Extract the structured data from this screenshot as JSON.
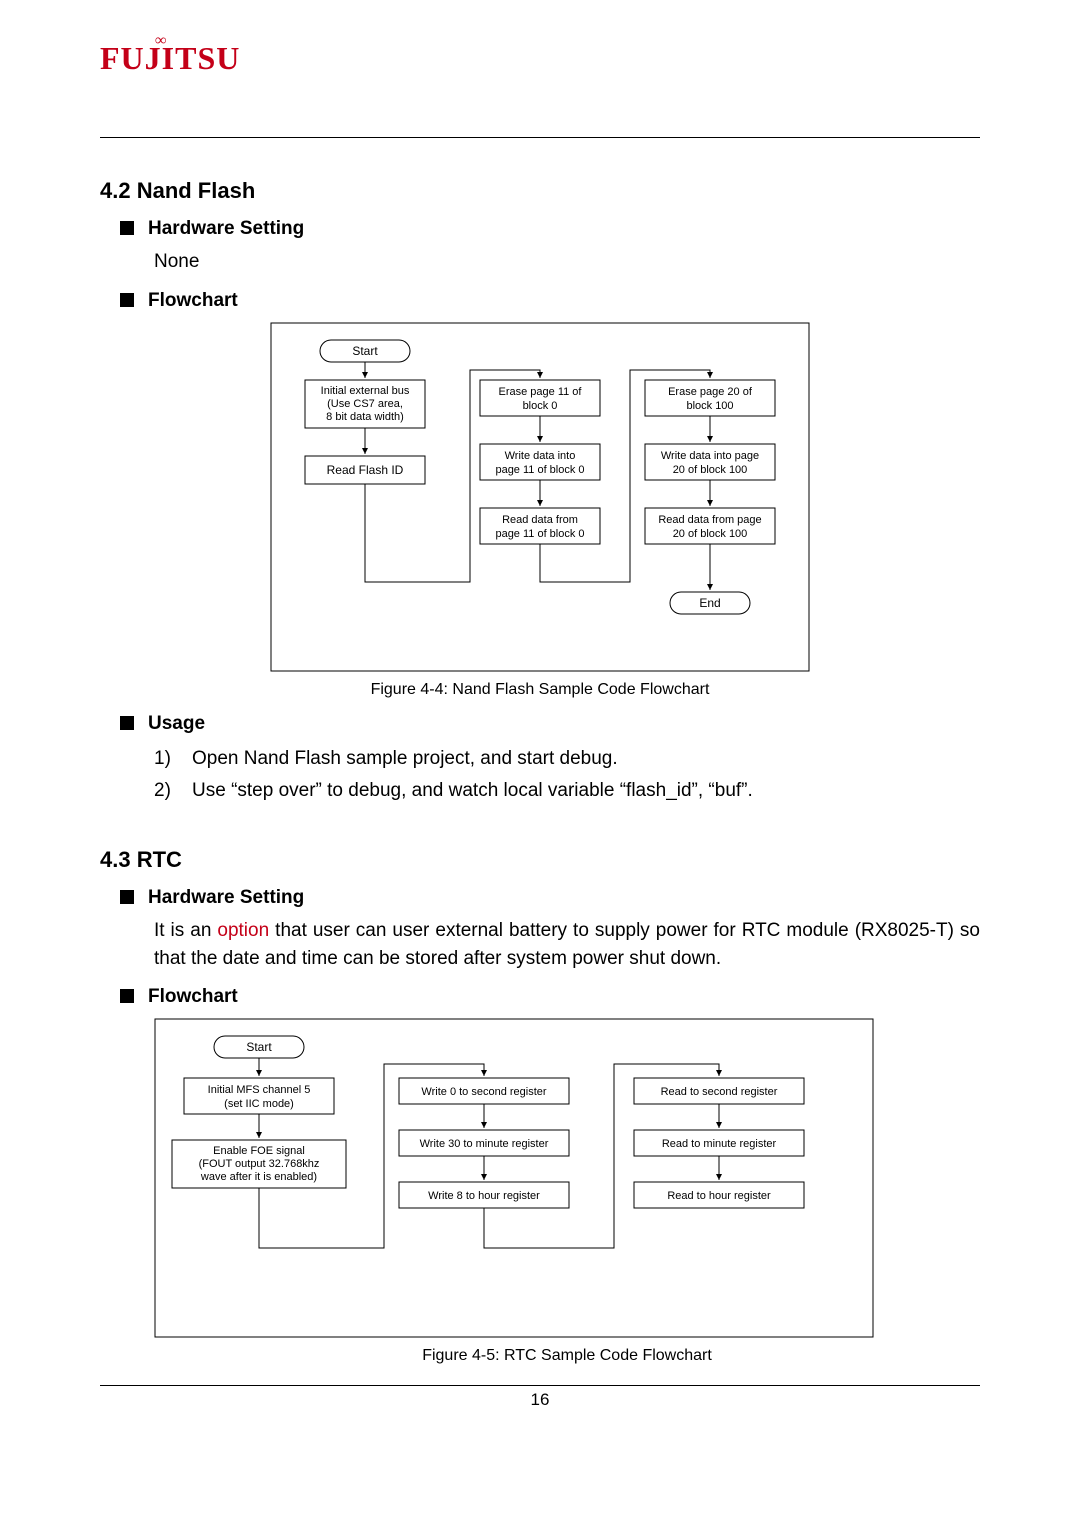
{
  "logo": "FUJITSU",
  "section_42": {
    "heading": "4.2 Nand Flash",
    "hw_label": "Hardware Setting",
    "hw_value": "None",
    "flow_label": "Flowchart",
    "usage_label": "Usage",
    "usage_items": [
      "Open Nand Flash sample project, and start debug.",
      "Use “step over” to debug, and watch local variable “flash_id”, “buf”."
    ],
    "fig_caption": "Figure 4-4:  Nand Flash Sample Code Flowchart"
  },
  "section_43": {
    "heading": "4.3 RTC",
    "hw_label": "Hardware Setting",
    "hw_text_pre": "It is an ",
    "hw_text_option": "option",
    "hw_text_post": " that user can user external battery to supply power for RTC module (RX8025-T) so that the date and time can be stored after system power shut down.",
    "flow_label": "Flowchart",
    "fig_caption": "Figure 4-5:  RTC Sample Code Flowchart"
  },
  "page_number": "16",
  "chart_data": [
    {
      "type": "flowchart",
      "title": "Nand Flash Sample Code Flowchart",
      "columns": [
        {
          "nodes": [
            {
              "shape": "terminator",
              "label": "Start"
            },
            {
              "shape": "process",
              "label": "Initial external bus (Use CS7 area, 8 bit data width)"
            },
            {
              "shape": "process",
              "label": "Read Flash ID"
            }
          ]
        },
        {
          "nodes": [
            {
              "shape": "process",
              "label": "Erase page 11 of block 0"
            },
            {
              "shape": "process",
              "label": "Write data into page 11 of block 0"
            },
            {
              "shape": "process",
              "label": "Read data from page 11 of block 0"
            }
          ]
        },
        {
          "nodes": [
            {
              "shape": "process",
              "label": "Erase page 20 of block 100"
            },
            {
              "shape": "process",
              "label": "Write data into page 20 of block 100"
            },
            {
              "shape": "process",
              "label": "Read data from page 20 of block 100"
            },
            {
              "shape": "terminator",
              "label": "End"
            }
          ]
        }
      ],
      "cross_links": [
        {
          "from": "col0.bottom",
          "to": "col1.top"
        },
        {
          "from": "col1.bottom",
          "to": "col2.top"
        }
      ]
    },
    {
      "type": "flowchart",
      "title": "RTC Sample Code Flowchart",
      "columns": [
        {
          "nodes": [
            {
              "shape": "terminator",
              "label": "Start"
            },
            {
              "shape": "process",
              "label": "Initial MFS channel 5 (set IIC mode)"
            },
            {
              "shape": "process",
              "label": "Enable FOE signal (FOUT output 32.768khz wave after it is enabled)"
            }
          ]
        },
        {
          "nodes": [
            {
              "shape": "process",
              "label": "Write 0 to second register"
            },
            {
              "shape": "process",
              "label": "Write 30 to minute register"
            },
            {
              "shape": "process",
              "label": "Write 8 to hour register"
            }
          ]
        },
        {
          "nodes": [
            {
              "shape": "process",
              "label": "Read to second register"
            },
            {
              "shape": "process",
              "label": "Read to minute register"
            },
            {
              "shape": "process",
              "label": "Read to hour register"
            }
          ]
        }
      ],
      "cross_links": [
        {
          "from": "col0.bottom",
          "to": "col1.top"
        },
        {
          "from": "col1.bottom",
          "to": "col2.top"
        }
      ]
    }
  ],
  "fc1": {
    "start": "Start",
    "c0n1a": "Initial external bus",
    "c0n1b": "(Use CS7 area,",
    "c0n1c": "8 bit data width)",
    "c0n2": "Read Flash ID",
    "c1n1a": "Erase page 11 of",
    "c1n1b": "block 0",
    "c1n2a": "Write data into",
    "c1n2b": "page 11 of block 0",
    "c1n3a": "Read data from",
    "c1n3b": "page 11 of block 0",
    "c2n1a": "Erase page 20 of",
    "c2n1b": "block 100",
    "c2n2a": "Write data into page",
    "c2n2b": "20 of block 100",
    "c2n3a": "Read data from page",
    "c2n3b": "20 of block 100",
    "end": "End"
  },
  "fc2": {
    "start": "Start",
    "c0n1a": "Initial MFS channel 5",
    "c0n1b": "(set IIC mode)",
    "c0n2a": "Enable FOE signal",
    "c0n2b": "(FOUT output 32.768khz",
    "c0n2c": "wave after it is enabled)",
    "c1n1": "Write 0 to second register",
    "c1n2": "Write 30 to minute register",
    "c1n3": "Write 8 to hour register",
    "c2n1": "Read to second register",
    "c2n2": "Read to minute register",
    "c2n3": "Read to hour register"
  }
}
